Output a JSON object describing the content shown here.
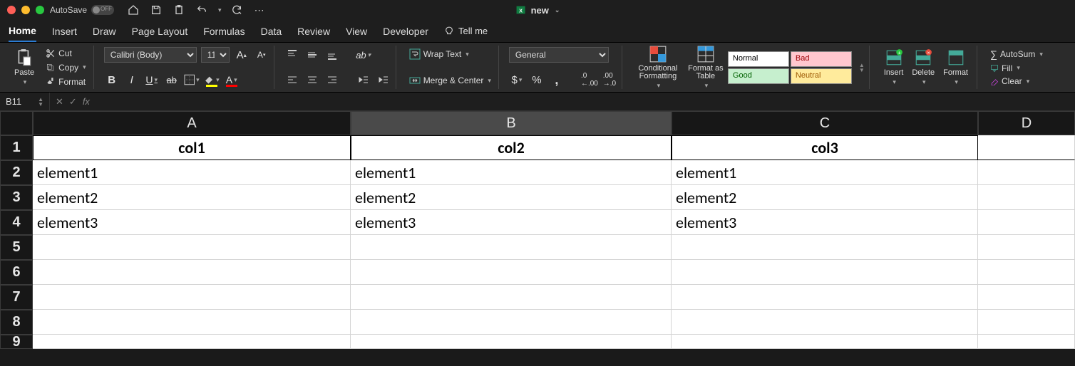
{
  "titlebar": {
    "autosave_label": "AutoSave",
    "doc_name": "new"
  },
  "tabs": [
    "Home",
    "Insert",
    "Draw",
    "Page Layout",
    "Formulas",
    "Data",
    "Review",
    "View",
    "Developer"
  ],
  "tellme": "Tell me",
  "ribbon": {
    "paste": "Paste",
    "cut": "Cut",
    "copy": "Copy",
    "format_painter": "Format",
    "font_name": "Calibri (Body)",
    "font_size": "11",
    "wrap": "Wrap Text",
    "merge": "Merge & Center",
    "number_format": "General",
    "cond_fmt": "Conditional Formatting",
    "fmt_table": "Format as Table",
    "styles": {
      "normal": "Normal",
      "bad": "Bad",
      "good": "Good",
      "neutral": "Neutral"
    },
    "insert": "Insert",
    "delete": "Delete",
    "format": "Format",
    "autosum": "AutoSum",
    "fill": "Fill",
    "clear": "Clear"
  },
  "namebox": "B11",
  "columns": [
    "A",
    "B",
    "C",
    "D"
  ],
  "rows": [
    "1",
    "2",
    "3",
    "4",
    "5",
    "6",
    "7",
    "8",
    "9"
  ],
  "cells": {
    "A1": "col1",
    "B1": "col2",
    "C1": "col3",
    "A2": "element1",
    "B2": "element1",
    "C2": "element1",
    "A3": "element2",
    "B3": "element2",
    "C3": "element2",
    "A4": "element3",
    "B4": "element3",
    "C4": "element3"
  }
}
